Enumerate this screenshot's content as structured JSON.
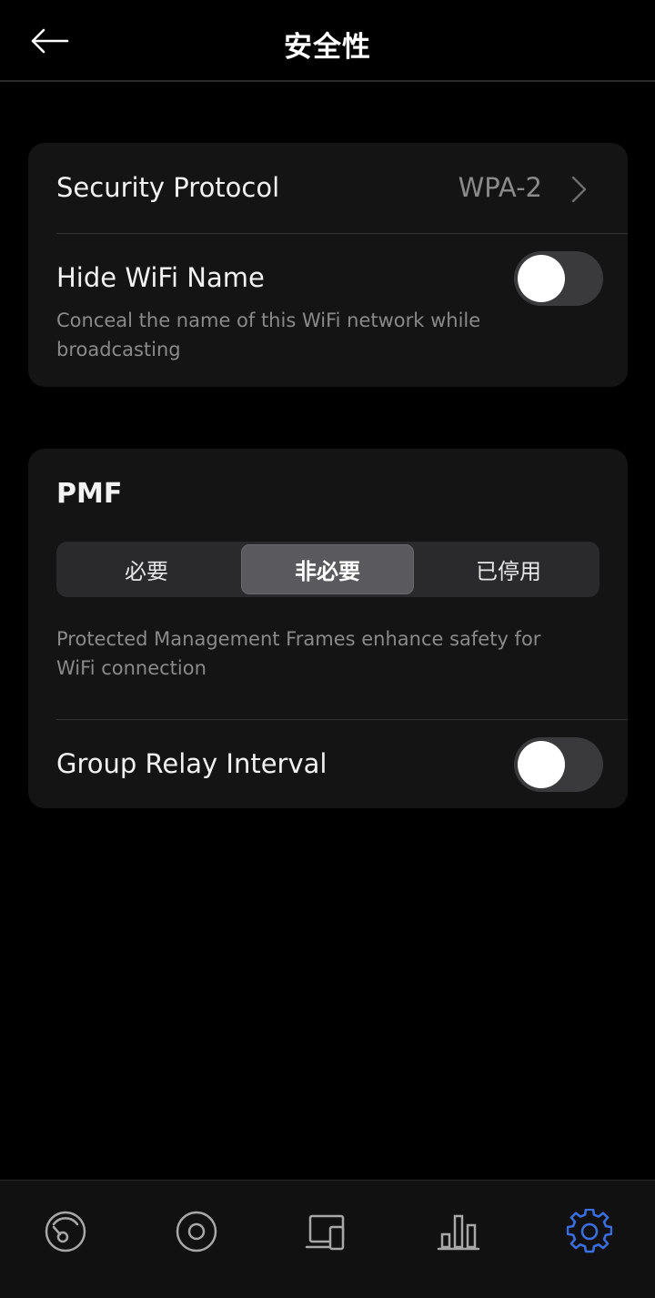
{
  "header": {
    "title": "安全性",
    "back_icon": "arrow-left-icon"
  },
  "security_card": {
    "protocol_label": "Security Protocol",
    "protocol_value": "WPA-2",
    "hide_wifi_label": "Hide WiFi Name",
    "hide_wifi_desc": "Conceal the name of this WiFi network while broadcasting",
    "hide_wifi_on": false
  },
  "pmf_card": {
    "title": "PMF",
    "options": [
      "必要",
      "非必要",
      "已停用"
    ],
    "selected_option": "非必要",
    "desc": "Protected Management Frames enhance safety for WiFi connection",
    "group_relay_label": "Group Relay Interval",
    "group_relay_on": false
  },
  "bottom_nav": {
    "items": [
      {
        "icon": "speedometer-icon",
        "active": false
      },
      {
        "icon": "target-icon",
        "active": false
      },
      {
        "icon": "devices-icon",
        "active": false
      },
      {
        "icon": "bar-chart-icon",
        "active": false
      },
      {
        "icon": "gear-icon",
        "active": true
      }
    ]
  },
  "colors": {
    "background": "#000000",
    "card": "#141414",
    "accent": "#3b6fe0",
    "muted_text": "#8a8a8a"
  }
}
